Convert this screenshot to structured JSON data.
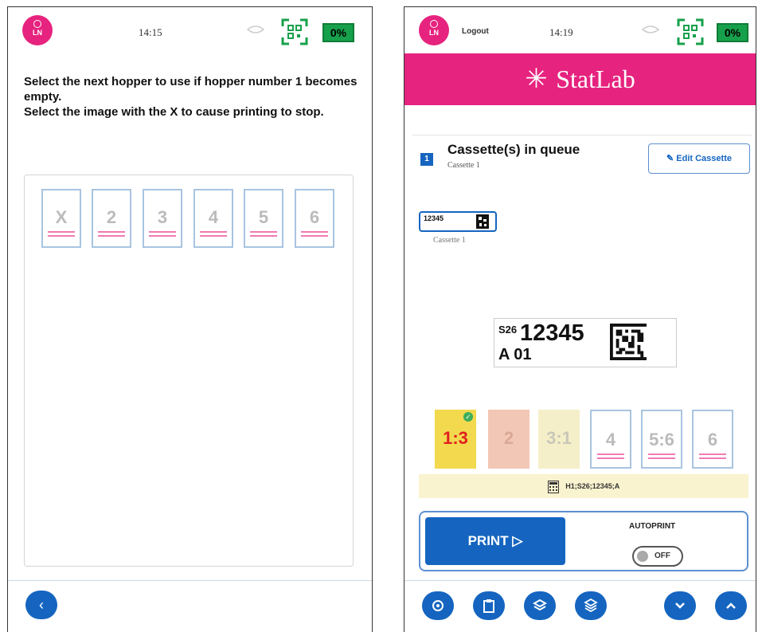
{
  "left": {
    "status": {
      "avatar_initials": "LN",
      "time": "14:15",
      "battery": "0%"
    },
    "instructions": [
      "Select the next hopper to use if hopper number 1 becomes empty.",
      "Select the image with the X to cause printing to stop."
    ],
    "hoppers": [
      "X",
      "2",
      "3",
      "4",
      "5",
      "6"
    ],
    "footer": {
      "back_icon": "chevron-left-icon",
      "back_glyph": "‹"
    }
  },
  "right": {
    "status": {
      "avatar_initials": "LN",
      "logout": "Logout",
      "time": "14:19",
      "battery": "0%"
    },
    "brand": {
      "star": "✳",
      "name": "StatLab"
    },
    "queue": {
      "count": "1",
      "title": "Cassette(s) in queue",
      "subtitle": "Cassette 1",
      "edit_label": "Edit Cassette",
      "edit_icon": "✎"
    },
    "thumbnail": {
      "text": "12345",
      "caption": "Cassette 1"
    },
    "label": {
      "prefix": "S26",
      "number": "12345",
      "line2": "A 01"
    },
    "slots": [
      {
        "num": "1:3",
        "style": "yellow",
        "checked": true
      },
      {
        "num": "2",
        "style": "salmon",
        "checked": false
      },
      {
        "num": "3:1",
        "style": "cream",
        "checked": false
      },
      {
        "num": "4",
        "style": "blue",
        "checked": false
      },
      {
        "num": "5:6",
        "style": "blue",
        "checked": false
      },
      {
        "num": "6",
        "style": "blue",
        "checked": false
      }
    ],
    "info_text": "H1;S26;12345;A",
    "print": {
      "label": "PRINT ▷",
      "autoprint_label": "AUTOPRINT",
      "toggle_state": "OFF"
    },
    "footer": [
      "settings-icon",
      "clipboard-icon",
      "layers-icon",
      "stack-icon",
      "chevron-down-icon",
      "chevron-up-icon"
    ]
  },
  "colors": {
    "brand_pink": "#e6237e",
    "primary_blue": "#1565c0",
    "battery_green": "#17a04b"
  }
}
